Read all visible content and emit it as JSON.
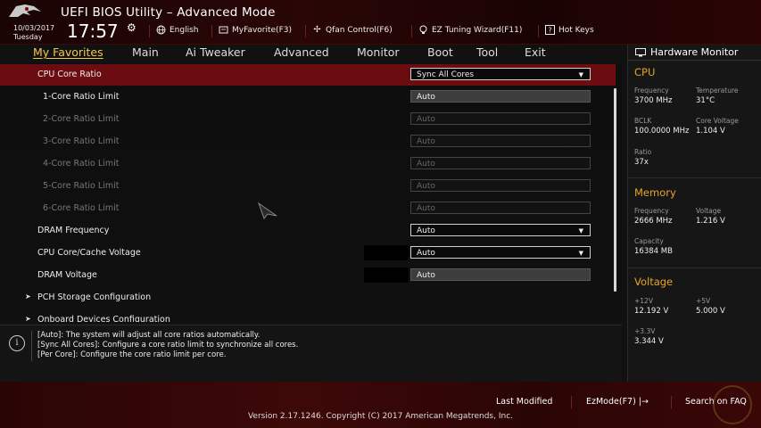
{
  "header": {
    "title": "UEFI BIOS Utility – Advanced Mode",
    "date": "10/03/2017",
    "day": "Tuesday",
    "time": "17:57",
    "items": [
      {
        "label": "English",
        "icon": "globe-icon"
      },
      {
        "label": "MyFavorite(F3)",
        "icon": "favorite-icon"
      },
      {
        "label": "Qfan Control(F6)",
        "icon": "fan-icon"
      },
      {
        "label": "EZ Tuning Wizard(F11)",
        "icon": "bulb-icon"
      },
      {
        "label": "Hot Keys",
        "icon": "help-icon"
      }
    ]
  },
  "nav": {
    "tabs": [
      "My Favorites",
      "Main",
      "Ai Tweaker",
      "Advanced",
      "Monitor",
      "Boot",
      "Tool",
      "Exit"
    ],
    "active": "My Favorites"
  },
  "settings": [
    {
      "label": "CPU Core Ratio",
      "value": "Sync All Cores",
      "type": "dropdown",
      "selected": true
    },
    {
      "label": "1-Core Ratio Limit",
      "value": "Auto",
      "type": "field"
    },
    {
      "label": "2-Core Ratio Limit",
      "value": "Auto",
      "type": "field-dim"
    },
    {
      "label": "3-Core Ratio Limit",
      "value": "Auto",
      "type": "field-dim"
    },
    {
      "label": "4-Core Ratio Limit",
      "value": "Auto",
      "type": "field-dim"
    },
    {
      "label": "5-Core Ratio Limit",
      "value": "Auto",
      "type": "field-dim"
    },
    {
      "label": "6-Core Ratio Limit",
      "value": "Auto",
      "type": "field-dim"
    },
    {
      "label": "DRAM Frequency",
      "value": "Auto",
      "type": "dropdown"
    },
    {
      "label": "CPU Core/Cache Voltage",
      "value": "Auto",
      "type": "dropdown"
    },
    {
      "label": "DRAM Voltage",
      "value": "Auto",
      "type": "field"
    },
    {
      "label": "PCH Storage Configuration",
      "type": "section"
    },
    {
      "label": "Onboard Devices Configuration",
      "type": "section"
    }
  ],
  "help": {
    "lines": [
      "[Auto]: The system will adjust all core ratios automatically.",
      "[Sync All Cores]: Configure a core ratio limit to synchronize all cores.",
      "[Per Core]: Configure the core ratio limit per core."
    ]
  },
  "hardware_monitor": {
    "title": "Hardware Monitor",
    "cpu": {
      "title": "CPU",
      "frequency_label": "Frequency",
      "frequency": "3700 MHz",
      "temperature_label": "Temperature",
      "temperature": "31°C",
      "bclk_label": "BCLK",
      "bclk": "100.0000 MHz",
      "core_voltage_label": "Core Voltage",
      "core_voltage": "1.104 V",
      "ratio_label": "Ratio",
      "ratio": "37x"
    },
    "memory": {
      "title": "Memory",
      "frequency_label": "Frequency",
      "frequency": "2666 MHz",
      "voltage_label": "Voltage",
      "voltage": "1.216 V",
      "capacity_label": "Capacity",
      "capacity": "16384 MB"
    },
    "voltage": {
      "title": "Voltage",
      "v12_label": "+12V",
      "v12": "12.192 V",
      "v5_label": "+5V",
      "v5": "5.000 V",
      "v33_label": "+3.3V",
      "v33": "3.344 V"
    }
  },
  "footer": {
    "last_modified": "Last Modified",
    "ezmode": "EzMode(F7)",
    "search": "Search on FAQ",
    "copyright": "Version 2.17.1246. Copyright (C) 2017 American Megatrends, Inc."
  },
  "colors": {
    "accent": "#e4a52a",
    "active_tab": "#f3c74a",
    "selected_row": "#6b0d10",
    "header_red": "#3d0808"
  }
}
